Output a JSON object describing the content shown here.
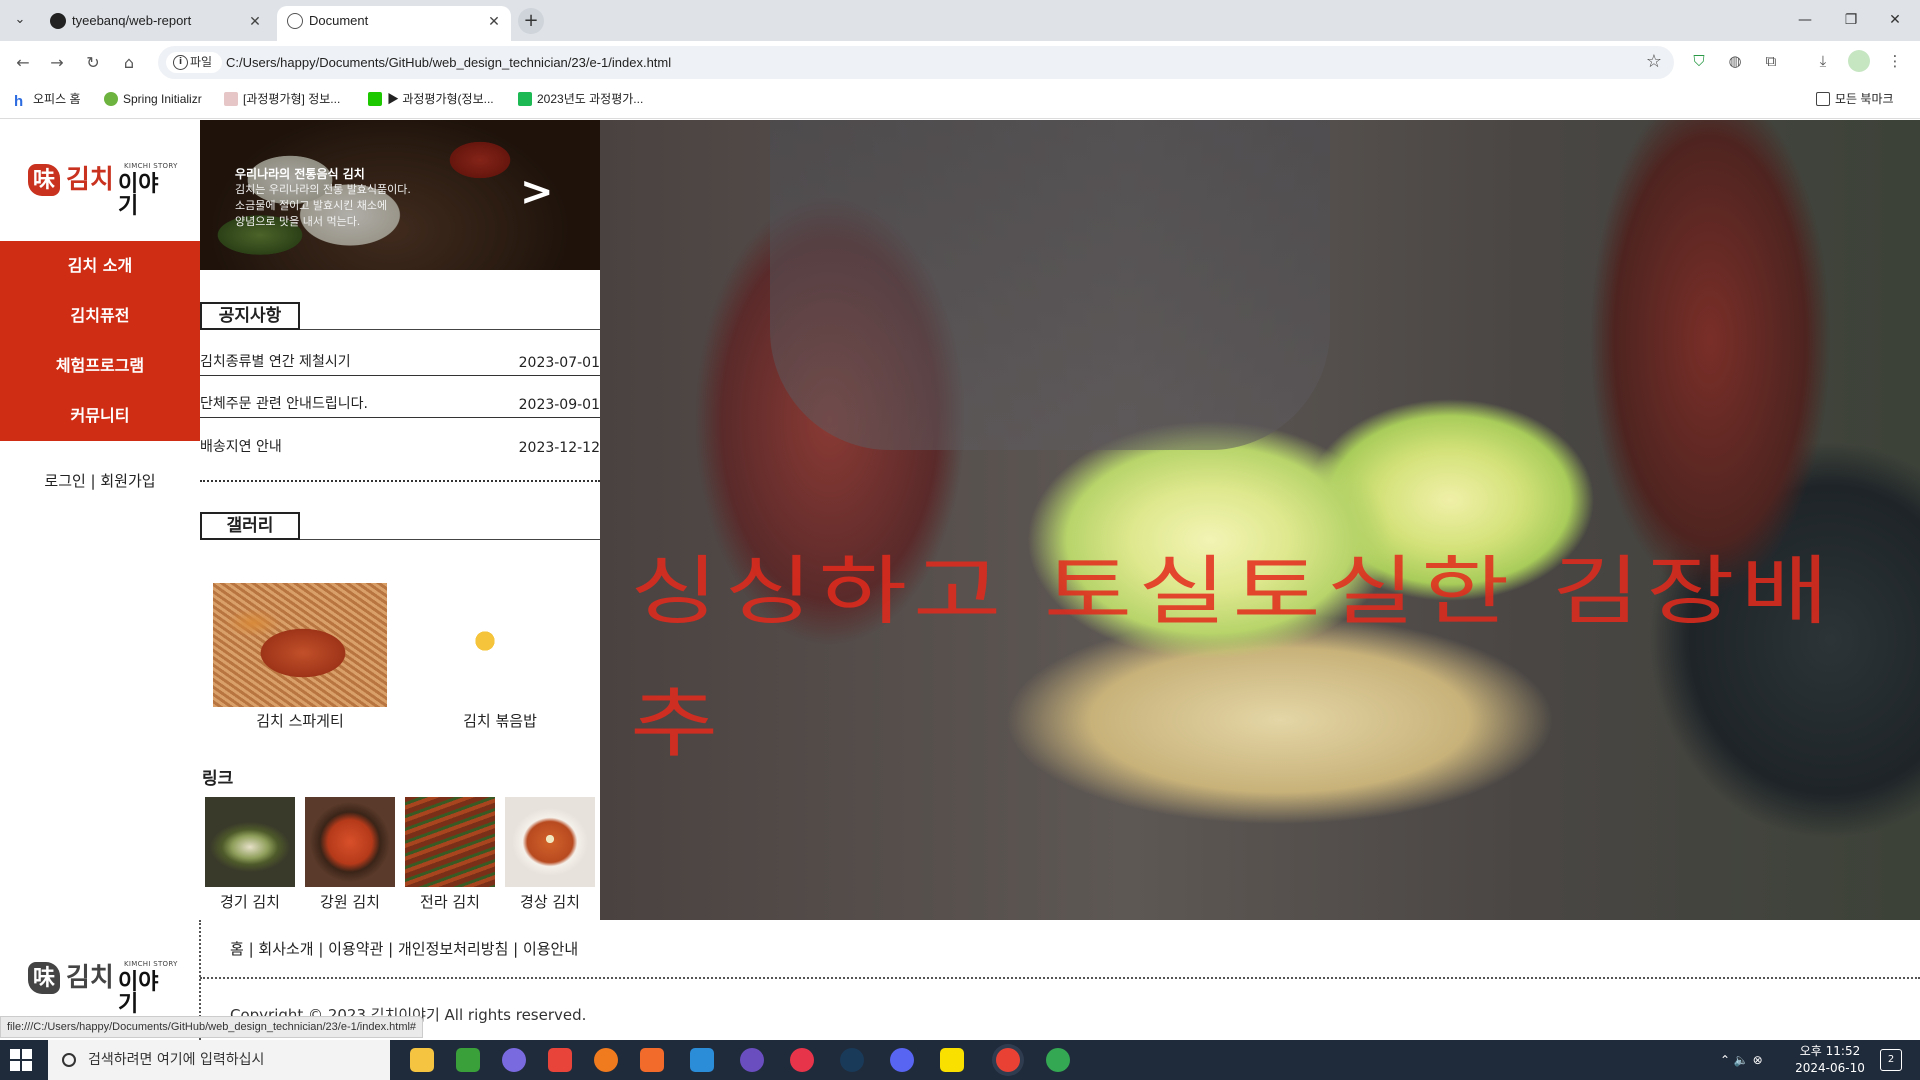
{
  "browser": {
    "tabs": [
      {
        "title": "tyeebanq/web-report"
      },
      {
        "title": "Document"
      }
    ],
    "new_tab_label": "+",
    "address": {
      "scheme_label": "파일",
      "url": "C:/Users/happy/Documents/GitHub/web_design_technician/23/e-1/index.html"
    },
    "bookmarks": [
      {
        "label": "오피스 홈"
      },
      {
        "label": "Spring Initializr"
      },
      {
        "label": "[과정평가형] 정보..."
      },
      {
        "label": "▶ 과정평가형(정보..."
      },
      {
        "label": "2023년도 과정평가..."
      },
      {
        "label": "모든 북마크"
      }
    ],
    "status_url": "file:///C:/Users/happy/Documents/GitHub/web_design_technician/23/e-1/index.html#"
  },
  "site": {
    "logo": {
      "mark": "味",
      "kimchi": "김치",
      "story": "이야기",
      "sub": "KIMCHI STORY"
    },
    "nav": [
      "김치 소개",
      "김치퓨전",
      "체험프로그램",
      "커뮤니티"
    ],
    "login": "로그인 | 회원가입",
    "banner": {
      "title": "우리나라의 전통음식 김치",
      "lines": [
        "김치는 우리나라의 전통 발효식품이다.",
        "소금물에 절이고 발효시킨 채소에",
        "양념으로 맛을 내서 먹는다."
      ],
      "arrow": ">"
    },
    "notice": {
      "heading": "공지사항",
      "items": [
        {
          "title": "김치종류별 연간 제철시기",
          "date": "2023-07-01"
        },
        {
          "title": "단체주문 관련 안내드립니다.",
          "date": "2023-09-01"
        },
        {
          "title": "배송지연 안내",
          "date": "2023-12-12"
        }
      ]
    },
    "gallery": {
      "heading": "갤러리",
      "items": [
        {
          "caption": "김치 스파게티"
        },
        {
          "caption": "김치 볶음밥"
        }
      ]
    },
    "links": {
      "heading": "링크",
      "items": [
        {
          "caption": "경기 김치"
        },
        {
          "caption": "강원 김치"
        },
        {
          "caption": "전라 김치"
        },
        {
          "caption": "경상 김치"
        }
      ]
    },
    "hero_text": "싱싱하고 토실토실한 김장배추",
    "footer": {
      "links": "홈 | 회사소개 | 이용약관 | 개인정보처리방침 | 이용안내",
      "copyright": "Copyright © 2023 김치이야기 All rights reserved."
    }
  },
  "taskbar": {
    "search_placeholder": "검색하려면 여기에 입력하십시",
    "time": "오후 11:52",
    "date": "2024-06-10",
    "notifications": "2"
  }
}
